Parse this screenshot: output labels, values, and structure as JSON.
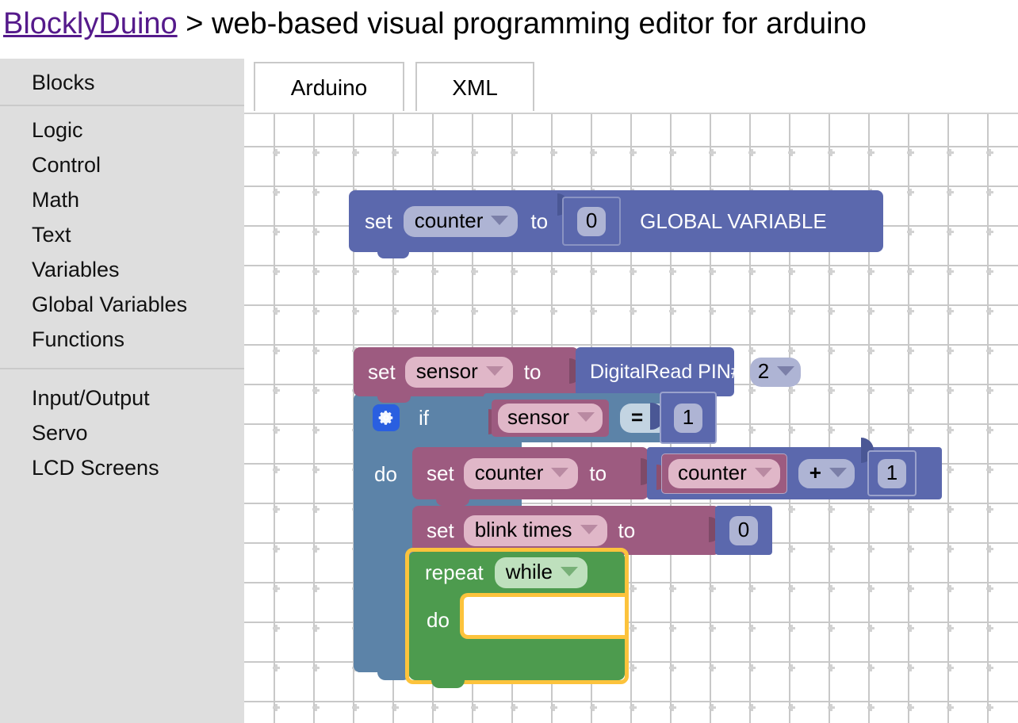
{
  "header": {
    "brand": "BlocklyDuino",
    "separator": " > ",
    "tagline": "web-based visual programming editor for arduino"
  },
  "sidebar": {
    "heading": "Blocks",
    "group1": [
      {
        "label": "Logic"
      },
      {
        "label": "Control"
      },
      {
        "label": "Math"
      },
      {
        "label": "Text"
      },
      {
        "label": "Variables"
      },
      {
        "label": "Global Variables"
      },
      {
        "label": "Functions"
      }
    ],
    "group2": [
      {
        "label": "Input/Output"
      },
      {
        "label": "Servo"
      },
      {
        "label": "LCD Screens"
      }
    ]
  },
  "tabs": [
    {
      "label": "Arduino",
      "selected": true
    },
    {
      "label": "XML",
      "selected": false
    }
  ],
  "workspace": {
    "blocks": {
      "global_var": {
        "set_label": "set",
        "variable": "counter",
        "to_label": "to",
        "value": "0",
        "annotation": "GLOBAL VARIABLE"
      },
      "set_sensor": {
        "set_label": "set",
        "variable": "sensor",
        "to_label": "to",
        "value_block": "DigitalRead PIN#",
        "pin": "2"
      },
      "if_block": {
        "gear_icon": "gear-icon",
        "if_label": "if",
        "do_label": "do",
        "condition": {
          "left_variable": "sensor",
          "operator": "=",
          "right_value": "1"
        }
      },
      "set_counter": {
        "set_label": "set",
        "variable": "counter",
        "to_label": "to",
        "expression": {
          "left_variable": "counter",
          "operator": "+",
          "right_value": "1"
        }
      },
      "set_blink_times": {
        "set_label": "set",
        "variable": "blink times",
        "to_label": "to",
        "value": "0"
      },
      "repeat_block": {
        "repeat_label": "repeat",
        "mode": "while",
        "do_label": "do",
        "selected": true
      }
    },
    "colors": {
      "variables_purple": "#5b68ad",
      "variables_pink": "#9d5b80",
      "control_steel": "#5c83a8",
      "loops_green": "#4d9b4e",
      "selection_highlight": "#fcc33c",
      "grid_dot": "#d2d2d2",
      "sidebar_bg": "#dedede",
      "brand_link": "#551a8b"
    }
  }
}
